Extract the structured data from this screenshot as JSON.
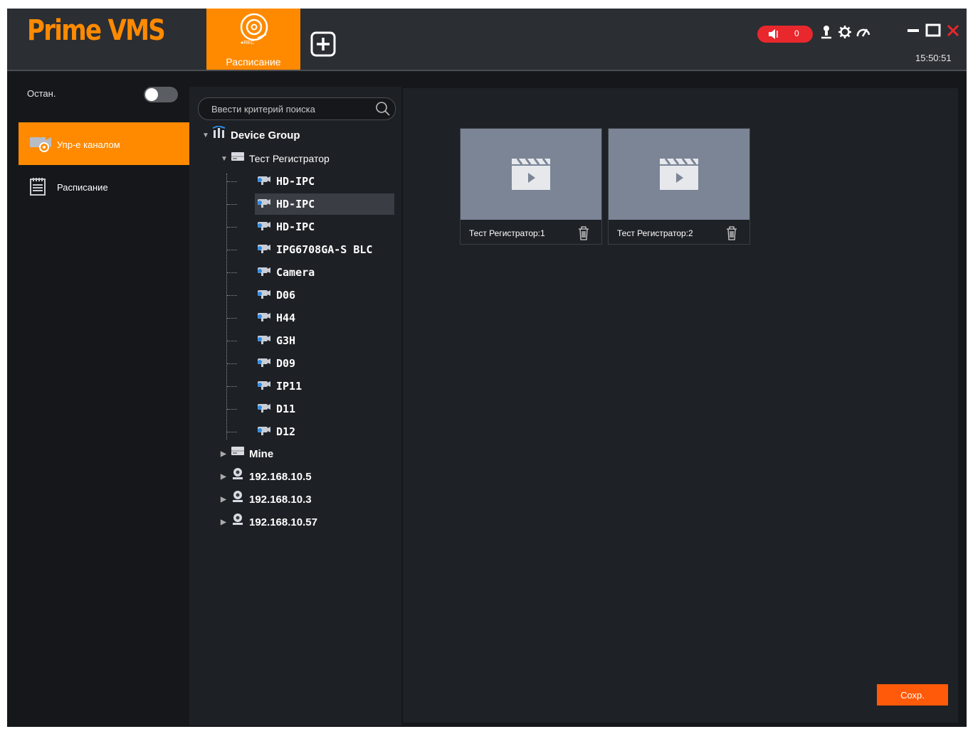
{
  "app": {
    "logo": "Prime VMS",
    "tab_schedule_label": "Расписание",
    "tab_schedule_rec": "●REC",
    "alarm_count": "0",
    "clock": "15:50:51",
    "accent": "#ff8a00",
    "alarm_color": "#e8282c"
  },
  "leftnav": {
    "stop_label": "Остан.",
    "stop_toggle_on": false,
    "items": [
      {
        "label": "Упр-е каналом",
        "icon": "channel-manage-icon",
        "active": true
      },
      {
        "label": "Расписание",
        "icon": "schedule-notepad-icon",
        "active": false
      }
    ]
  },
  "tree": {
    "search_placeholder": "Ввести критерий поиска",
    "root": "Device Group",
    "recorder": "Тест Регистратор",
    "channels": [
      "HD-IPC",
      "HD-IPC",
      "HD-IPC",
      "IPG6708GA-S BLC",
      "Camera",
      "D06",
      "H44",
      "G3H",
      "D09",
      "IP11",
      "D11",
      "D12"
    ],
    "selected_index": 1,
    "others": [
      "Mine",
      "192.168.10.5",
      "192.168.10.3",
      "192.168.10.57"
    ]
  },
  "main": {
    "cards": [
      {
        "label": "Тест Регистратор:1"
      },
      {
        "label": "Тест Регистратор:2"
      }
    ],
    "save_label": "Сохр."
  }
}
